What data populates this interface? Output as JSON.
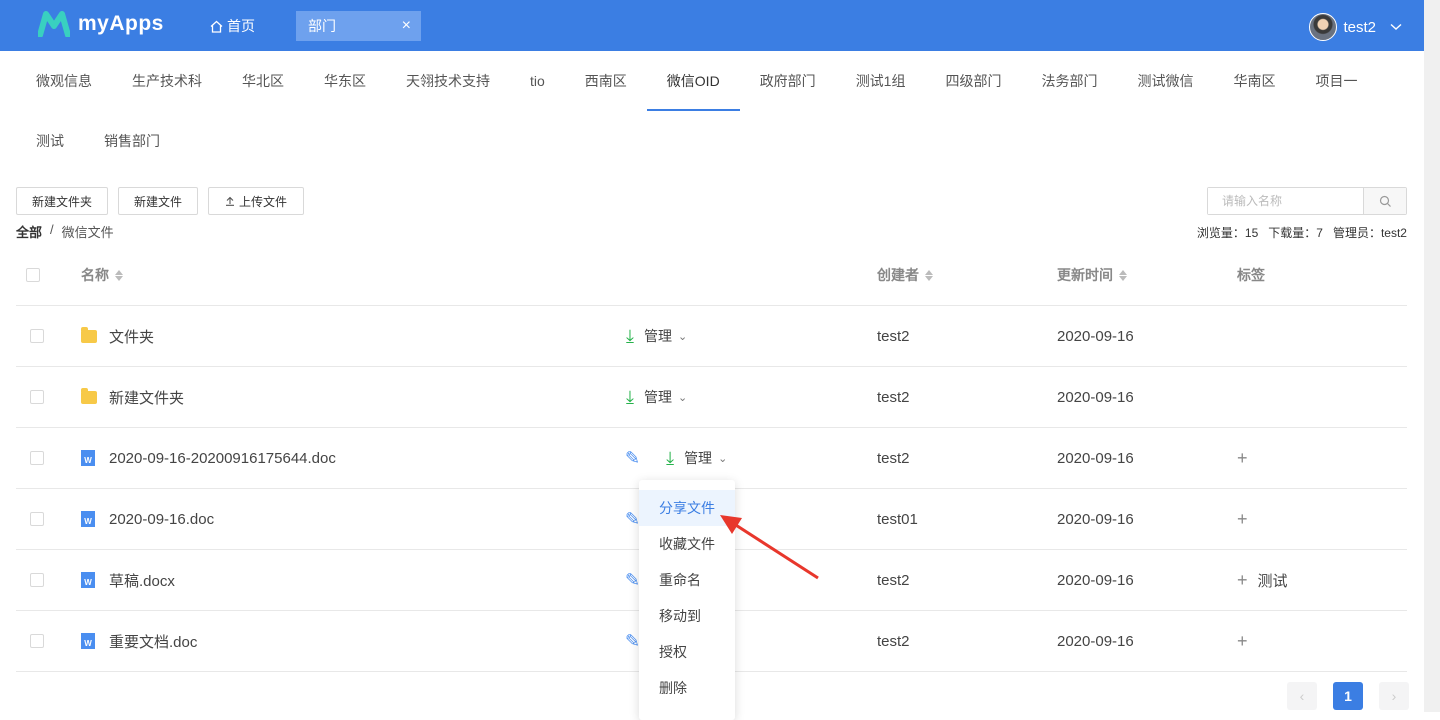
{
  "header": {
    "app_name": "myApps",
    "home_label": "首页",
    "active_tab": "部门",
    "close_glyph": "×",
    "username": "test2"
  },
  "dept_tabs": [
    "微观信息",
    "生产技术科",
    "华北区",
    "华东区",
    "天翎技术支持",
    "tio",
    "西南区",
    "微信OID",
    "政府部门",
    "测试1组",
    "四级部门",
    "法务部门",
    "测试微信",
    "华南区",
    "项目一",
    "测试",
    "销售部门"
  ],
  "dept_tabs_active": "微信OID",
  "toolbar": {
    "new_folder": "新建文件夹",
    "new_file": "新建文件",
    "upload": "上传文件",
    "search_placeholder": "请输入名称"
  },
  "breadcrumb": {
    "root": "全部",
    "sep": "/",
    "current": "微信文件"
  },
  "stats": {
    "views": "浏览量：15",
    "downloads": "下载量：7",
    "admin": "管理员：test2"
  },
  "table": {
    "columns": {
      "name": "名称",
      "creator": "创建者",
      "updated": "更新时间",
      "tags": "标签"
    },
    "manage_label": "管理",
    "rows": [
      {
        "type": "folder",
        "name": "文件夹",
        "creator": "test2",
        "updated": "2020-09-16",
        "tag": ""
      },
      {
        "type": "folder",
        "name": "新建文件夹",
        "creator": "test2",
        "updated": "2020-09-16",
        "tag": ""
      },
      {
        "type": "doc",
        "name": "2020-09-16-20200916175644.doc",
        "creator": "test2",
        "updated": "2020-09-16",
        "tag": ""
      },
      {
        "type": "doc",
        "name": "2020-09-16.doc",
        "creator": "test01",
        "updated": "2020-09-16",
        "tag": ""
      },
      {
        "type": "doc",
        "name": "草稿.docx",
        "creator": "test2",
        "updated": "2020-09-16",
        "tag": "测试"
      },
      {
        "type": "doc",
        "name": "重要文档.doc",
        "creator": "test2",
        "updated": "2020-09-16",
        "tag": ""
      }
    ]
  },
  "dropdown": {
    "items": [
      "分享文件",
      "收藏文件",
      "重命名",
      "移动到",
      "授权",
      "删除"
    ],
    "hovered": "分享文件"
  },
  "pagination": {
    "current": "1",
    "prev": "‹",
    "next": "›"
  },
  "colors": {
    "brand": "#3b7ee3",
    "download": "#26b24b",
    "annotation_arrow": "#e8372c"
  }
}
